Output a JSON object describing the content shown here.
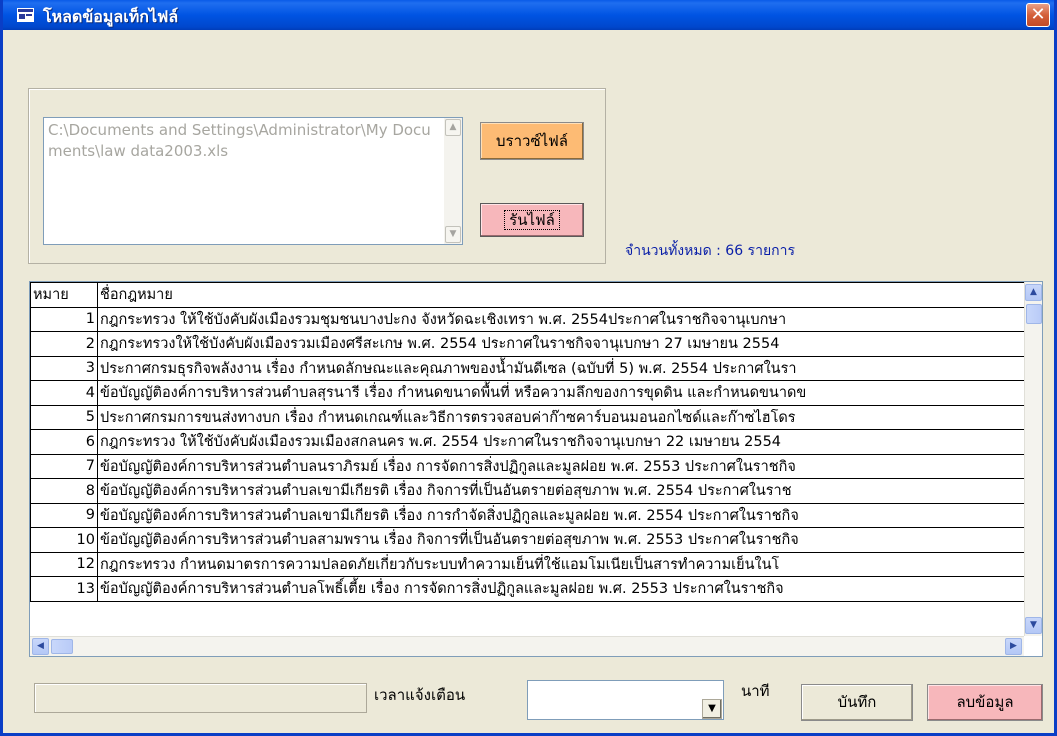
{
  "window": {
    "title": "โหลดข้อมูลเท็กไฟล์",
    "close_glyph": "✕"
  },
  "file": {
    "path": "C:\\Documents and Settings\\Administrator\\My Documents\\law data2003.xls"
  },
  "buttons": {
    "browse": "บราวซ์ไฟล์",
    "run": "รันไฟล์",
    "save": "บันทึก",
    "delete": "ลบข้อมูล"
  },
  "total_label": "จำนวนทั้งหมด : 66 รายการ",
  "grid": {
    "headers": [
      "หมาย",
      "ชื่อกฎหมาย"
    ],
    "rows": [
      {
        "no": "1",
        "name": "กฎกระทรวง ให้ใช้บังคับผังเมืองรวมชุมชนบางปะกง จังหวัดฉะเชิงเทรา พ.ศ. 2554ประกาศในราชกิจจานุเบกษา"
      },
      {
        "no": "2",
        "name": "กฎกระทรวงให้ใช้บังคับผังเมืองรวมเมืองศรีสะเกษ พ.ศ. 2554 ประกาศในราชกิจจานุเบกษา 27 เมษายน 2554"
      },
      {
        "no": "3",
        "name": "ประกาศกรมธุรกิจพลังงาน เรื่อง กำหนดลักษณะและคุณภาพของน้ำมันดีเซล (ฉบับที่ 5) พ.ศ. 2554 ประกาศในรา"
      },
      {
        "no": "4",
        "name": "ข้อบัญญัติองค์การบริหารส่วนตำบลสุรนารี เรื่อง กำหนดขนาดพื้นที่ หรือความลึกของการขุดดิน และกำหนดขนาดข"
      },
      {
        "no": "5",
        "name": "ประกาศกรมการขนส่งทางบก เรื่อง กำหนดเกณฑ์และวิธีการตรวจสอบค่าก๊าซคาร์บอนมอนอกไซด์และก๊าซไฮโดร"
      },
      {
        "no": "6",
        "name": "กฎกระทรวง ให้ใช้บังคับผังเมืองรวมเมืองสกลนคร พ.ศ. 2554 ประกาศในราชกิจจานุเบกษา 22 เมษายน 2554"
      },
      {
        "no": "7",
        "name": "ข้อบัญญัติองค์การบริหารส่วนตำบลนราภิรมย์ เรื่อง การจัดการสิ่งปฏิกูลและมูลฝอย พ.ศ. 2553 ประกาศในราชกิจ"
      },
      {
        "no": "8",
        "name": "ข้อบัญญัติองค์การบริหารส่วนตำบลเขามีเกียรติ เรื่อง กิจการที่เป็นอันตรายต่อสุขภาพ พ.ศ. 2554 ประกาศในราช"
      },
      {
        "no": "9",
        "name": "ข้อบัญญัติองค์การบริหารส่วนตำบลเขามีเกียรติ เรื่อง การกำจัดสิ่งปฏิกูลและมูลฝอย พ.ศ. 2554 ประกาศในราชกิจ"
      },
      {
        "no": "10",
        "name": "ข้อบัญญัติองค์การบริหารส่วนตำบลสามพราน เรื่อง กิจการที่เป็นอันตรายต่อสุขภาพ พ.ศ. 2553 ประกาศในราชกิจ"
      },
      {
        "no": "12",
        "name": "กฎกระทรวง กำหนดมาตรการความปลอดภัยเกี่ยวกับระบบทำความเย็นที่ใช้แอมโมเนียเป็นสารทำความเย็นในโ"
      },
      {
        "no": "13",
        "name": "ข้อบัญญัติองค์การบริหารส่วนตำบลโพธิ์เตี้ย เรื่อง การจัดการสิ่งปฏิกูลและมูลฝอย พ.ศ. 2553 ประกาศในราชกิจ"
      }
    ]
  },
  "alert": {
    "label": "เวลาแจ้งเตือน",
    "value": "",
    "unit": "นาที"
  },
  "status_text": ""
}
